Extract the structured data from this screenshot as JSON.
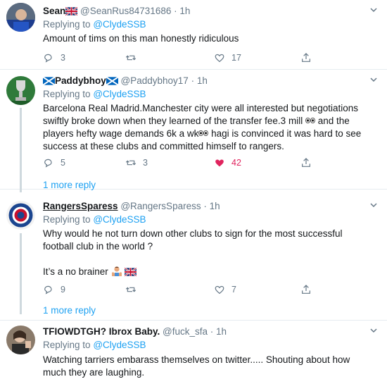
{
  "tweets": [
    {
      "name": "Sean",
      "name_emoji": "uk-flag",
      "handle": "@SeanRus84731686",
      "time": "1h",
      "replying_label": "Replying to",
      "replying_to": "@ClydeSSB",
      "body": "Amount of tims on this man honestly ridiculous",
      "replies": "3",
      "retweets": "",
      "likes": "17"
    },
    {
      "name": "Paddybhoy",
      "name_emoji": "scotland-flag",
      "handle": "@Paddybhoy17",
      "time": "1h",
      "replying_label": "Replying to",
      "replying_to": "@ClydeSSB",
      "body_line1": "Barcelona Real Madrid.Manchester city were all interested but negotiations",
      "body_line2a": "swiftly broke down when they learned of the transfer fee.3 mill",
      "body_line2b": "and the",
      "body_line3a": "players hefty wage demands 6k a wk",
      "body_line3b": "hagi is convinced it was hard to see",
      "body_line4": "success at these clubs and committed himself to rangers.",
      "replies": "5",
      "retweets": "3",
      "likes": "42",
      "more_replies": "1 more reply"
    },
    {
      "name": "RangersSparess",
      "handle": "@RangersSparess",
      "time": "1h",
      "replying_label": "Replying to",
      "replying_to": "@ClydeSSB",
      "body_line1": "Why would he not turn down other clubs to sign for the most successful",
      "body_line2": "football club in the world ?",
      "body_line3": "It’s a no brainer",
      "replies": "9",
      "retweets": "",
      "likes": "7",
      "more_replies": "1 more reply"
    },
    {
      "name": "TFIOWDTGH? Ibrox Baby.",
      "handle": "@fuck_sfa",
      "time": "1h",
      "replying_label": "Replying to",
      "replying_to": "@ClydeSSB",
      "body_line1": "Watching tarriers embarass themselves on twitter..... Shouting about how",
      "body_line2": "much they are laughing."
    }
  ],
  "colors": {
    "link": "#1da1f2",
    "muted": "#657786",
    "like_active": "#e0245e",
    "divider": "#e6ecf0"
  },
  "icons": [
    "reply-icon",
    "retweet-icon",
    "like-icon",
    "share-icon",
    "caret-down-icon",
    "uk-flag-icon",
    "scotland-flag-icon",
    "eyes-emoji-icon",
    "person-shrug-emoji-icon"
  ]
}
